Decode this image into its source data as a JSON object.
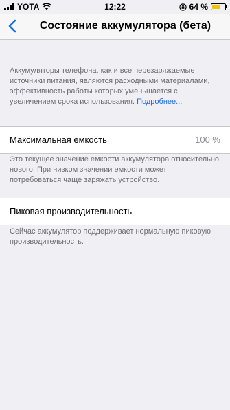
{
  "status_bar": {
    "carrier": "YOTA",
    "time": "12:22",
    "battery_percent": "64 %",
    "battery_level": 0.64,
    "battery_color": "#f5c400"
  },
  "nav": {
    "back_icon": "chevron-left-icon",
    "title": "Состояние аккумулятора (бета)"
  },
  "intro": {
    "text": "Аккумуляторы телефона, как и все перезаряжаемые источники питания, являются расходными материалами, эффективность работы которых уменьшается с увеличением срока использования.",
    "link": "Подробнее..."
  },
  "max_capacity": {
    "label": "Максимальная емкость",
    "value": "100 %",
    "description": "Это текущее значение емкости аккумулятора относительно нового. При низком значении емкости может потребоваться чаще заряжать устройство."
  },
  "peak_performance": {
    "label": "Пиковая производительность",
    "description": "Сейчас аккумулятор поддерживает нормальную пиковую производительность."
  },
  "colors": {
    "accent": "#1f6fe0",
    "background": "#efeff4"
  }
}
